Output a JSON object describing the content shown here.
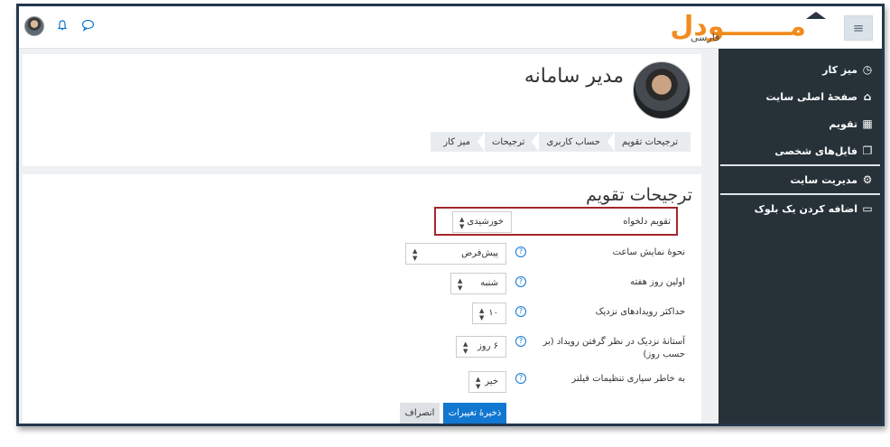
{
  "navbar": {
    "brand_main": "مـــــــودل",
    "brand_sub": "فارسی",
    "menu_toggle": "≡"
  },
  "drawer": {
    "items": [
      {
        "label": "میز کار",
        "icon": "dashboard-icon"
      },
      {
        "label": "صفحهٔ اصلی سایت",
        "icon": "home-icon"
      },
      {
        "label": "تقویم",
        "icon": "calendar-icon"
      },
      {
        "label": "فایل‌های شخصی",
        "icon": "files-icon"
      },
      {
        "label": "مدیریت سایت",
        "icon": "gear-icon"
      },
      {
        "label": "اضافه کردن یک بلوک",
        "icon": "folder-icon"
      }
    ]
  },
  "header": {
    "page_title": "مدیر سامانه",
    "breadcrumb": [
      "میز کار",
      "ترجیحات",
      "حساب کاربری",
      "ترجیحات تقویم"
    ]
  },
  "form": {
    "title": "ترجیحات تقویم",
    "fields": [
      {
        "label": "تقویم دلخواه",
        "value": "خورشیدی",
        "help": false
      },
      {
        "label": "نحوهٔ نمایش ساعت",
        "value": "پیش‌فرض",
        "help": true
      },
      {
        "label": "اولین روز هفته",
        "value": "شنبه",
        "help": true
      },
      {
        "label": "حداکثر رویدادهای نزدیک",
        "value": "۱۰",
        "help": true
      },
      {
        "label": "آستانهٔ نزدیک در نظر گرفتن رویداد (بر حسب روز)",
        "value": "۶ روز",
        "help": true
      },
      {
        "label": "به خاطر سپاری تنظیمات فیلتر",
        "value": "خیر",
        "help": true
      }
    ],
    "save_label": "ذخیرهٔ تغییرات",
    "cancel_label": "انصراف"
  },
  "colors": {
    "brand_orange": "#f08c1e",
    "drawer_bg": "#263238",
    "primary_button": "#1177d1",
    "highlight_border": "#a4262c"
  }
}
